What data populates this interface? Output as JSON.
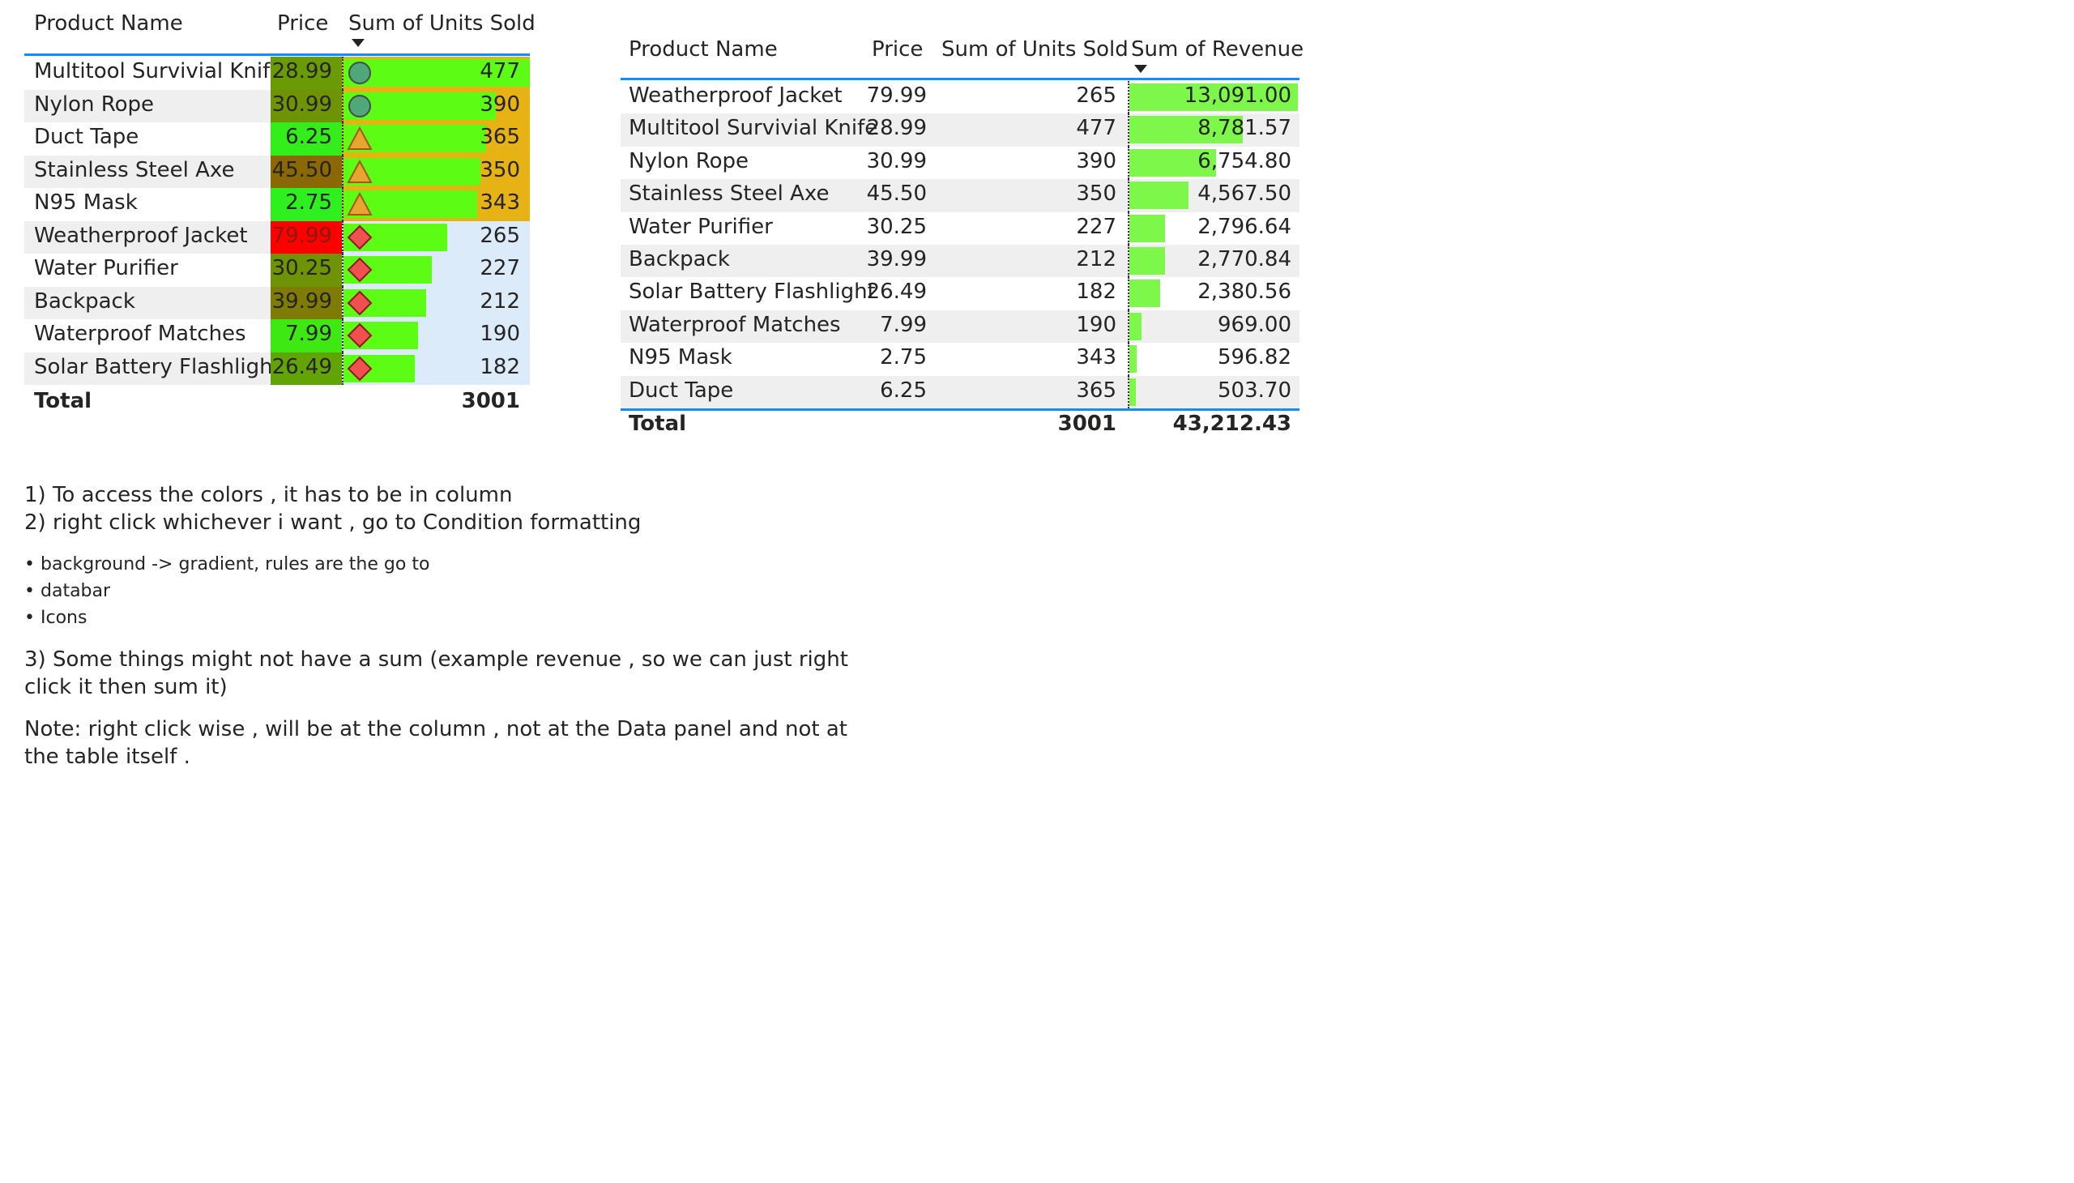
{
  "table1": {
    "headers": {
      "name": "Product Name",
      "price": "Price",
      "units": "Sum of Units Sold"
    },
    "rows": [
      {
        "name": "Multitool Survivial Knife",
        "price": "28.99",
        "units": "477",
        "units_value": 477,
        "price_bg": "#6a9a05",
        "price_color": "#252423",
        "icon": "circle-icon",
        "units_bg": "#e6b214"
      },
      {
        "name": "Nylon Rope",
        "price": "30.99",
        "units": "390",
        "units_value": 390,
        "price_bg": "#6e9305",
        "price_color": "#252423",
        "icon": "circle-icon",
        "units_bg": "#e6b214"
      },
      {
        "name": "Duct Tape",
        "price": "6.25",
        "units": "365",
        "units_value": 365,
        "price_bg": "#33ee1b",
        "price_color": "#252423",
        "icon": "triangle-icon",
        "units_bg": "#e6b214"
      },
      {
        "name": "Stainless Steel Axe",
        "price": "45.50",
        "units": "350",
        "units_value": 350,
        "price_bg": "#8a6805",
        "price_color": "#252423",
        "icon": "triangle-icon",
        "units_bg": "#e6b214"
      },
      {
        "name": "N95 Mask",
        "price": "2.75",
        "units": "343",
        "units_value": 343,
        "price_bg": "#2ef01f",
        "price_color": "#252423",
        "icon": "triangle-icon",
        "units_bg": "#e6b214"
      },
      {
        "name": "Weatherproof Jacket",
        "price": "79.99",
        "units": "265",
        "units_value": 265,
        "price_bg": "#ff0000",
        "price_color": "#8a1a10",
        "icon": "diamond-icon",
        "units_bg": "#dcebfa"
      },
      {
        "name": "Water Purifier",
        "price": "30.25",
        "units": "227",
        "units_value": 227,
        "price_bg": "#6e9305",
        "price_color": "#252423",
        "icon": "diamond-icon",
        "units_bg": "#dcebfa"
      },
      {
        "name": "Backpack",
        "price": "39.99",
        "units": "212",
        "units_value": 212,
        "price_bg": "#7e7c05",
        "price_color": "#252423",
        "icon": "diamond-icon",
        "units_bg": "#dcebfa"
      },
      {
        "name": "Waterproof Matches",
        "price": "7.99",
        "units": "190",
        "units_value": 190,
        "price_bg": "#3ee812",
        "price_color": "#252423",
        "icon": "diamond-icon",
        "units_bg": "#dcebfa"
      },
      {
        "name": "Solar Battery Flashlight",
        "price": "26.49",
        "units": "182",
        "units_value": 182,
        "price_bg": "#62a405",
        "price_color": "#252423",
        "icon": "diamond-icon",
        "units_bg": "#dcebfa"
      }
    ],
    "total": {
      "label": "Total",
      "units": "3001"
    },
    "colors": {
      "databar": "#5dfc14"
    }
  },
  "table2": {
    "headers": {
      "name": "Product Name",
      "price": "Price",
      "units": "Sum of Units Sold",
      "revenue": "Sum of Revenue"
    },
    "rows": [
      {
        "name": "Weatherproof Jacket",
        "price": "79.99",
        "units": "265",
        "revenue": "13,091.00",
        "revenue_value": 13091.0
      },
      {
        "name": "Multitool Survivial Knife",
        "price": "28.99",
        "units": "477",
        "revenue": "8,781.57",
        "revenue_value": 8781.57
      },
      {
        "name": "Nylon Rope",
        "price": "30.99",
        "units": "390",
        "revenue": "6,754.80",
        "revenue_value": 6754.8
      },
      {
        "name": "Stainless Steel Axe",
        "price": "45.50",
        "units": "350",
        "revenue": "4,567.50",
        "revenue_value": 4567.5
      },
      {
        "name": "Water Purifier",
        "price": "30.25",
        "units": "227",
        "revenue": "2,796.64",
        "revenue_value": 2796.64
      },
      {
        "name": "Backpack",
        "price": "39.99",
        "units": "212",
        "revenue": "2,770.84",
        "revenue_value": 2770.84
      },
      {
        "name": "Solar Battery Flashlight",
        "price": "26.49",
        "units": "182",
        "revenue": "2,380.56",
        "revenue_value": 2380.56
      },
      {
        "name": "Waterproof Matches",
        "price": "7.99",
        "units": "190",
        "revenue": "969.00",
        "revenue_value": 969.0
      },
      {
        "name": "N95 Mask",
        "price": "2.75",
        "units": "343",
        "revenue": "596.82",
        "revenue_value": 596.82
      },
      {
        "name": "Duct Tape",
        "price": "6.25",
        "units": "365",
        "revenue": "503.70",
        "revenue_value": 503.7
      }
    ],
    "total": {
      "label": "Total",
      "units": "3001",
      "revenue": "43,212.43"
    },
    "colors": {
      "databar": "#7cf74a"
    }
  },
  "notes": {
    "line1": "1) To access the colors , it has to be in column",
    "line2": "2) right click whichever i want , go to Condition formatting",
    "bullets": [
      "background -> gradient, rules are the go to",
      "databar",
      "Icons"
    ],
    "line3": "3) Some things might not have a sum (example revenue , so we can just right click it then sum it)",
    "note": "Note: right click wise , will be at the column , not at the Data panel and not at the table itself ."
  }
}
